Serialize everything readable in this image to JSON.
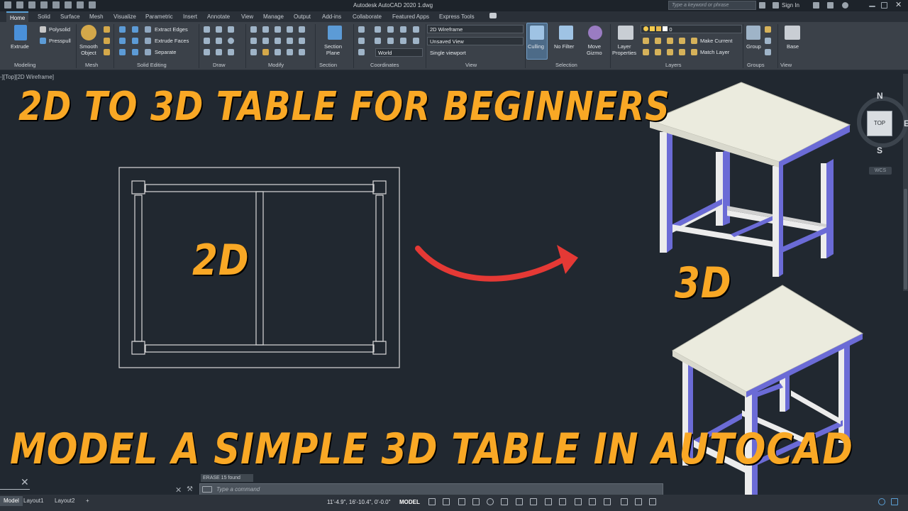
{
  "app": {
    "title": "Autodesk AutoCAD 2020    1.dwg",
    "search_placeholder": "Type a keyword or phrase",
    "sign_in": "Sign In"
  },
  "tabs": [
    "Home",
    "Solid",
    "Surface",
    "Mesh",
    "Visualize",
    "Parametric",
    "Insert",
    "Annotate",
    "View",
    "Manage",
    "Output",
    "Add-ins",
    "Collaborate",
    "Featured Apps",
    "Express Tools"
  ],
  "ribbon": {
    "modeling": {
      "extrude": "Extrude",
      "polysolid": "Polysolid",
      "presspull": "Presspull",
      "label": "Modeling"
    },
    "mesh": {
      "smooth_object_1": "Smooth",
      "smooth_object_2": "Object",
      "label": "Mesh"
    },
    "solid_editing": {
      "extract_edges": "Extract Edges",
      "extrude_faces": "Extrude Faces",
      "separate": "Separate",
      "label": "Solid Editing"
    },
    "draw": {
      "label": "Draw"
    },
    "modify": {
      "label": "Modify"
    },
    "section": {
      "plane_1": "Section",
      "plane_2": "Plane",
      "label": "Section"
    },
    "coordinates": {
      "ucs": "World",
      "label": "Coordinates"
    },
    "view": {
      "visual_style": "2D Wireframe",
      "named_view": "Unsaved View",
      "viewport": "Single viewport",
      "label": "View"
    },
    "selection": {
      "culling": "Culling",
      "no_filter": "No Filter",
      "move_gizmo_1": "Move",
      "move_gizmo_2": "Gizmo",
      "label": "Selection"
    },
    "layers": {
      "layer_properties_1": "Layer",
      "layer_properties_2": "Properties",
      "current_layer": "0",
      "make_current": "Make Current",
      "match_layer": "Match Layer",
      "label": "Layers"
    },
    "groups": {
      "group": "Group",
      "label": "Groups"
    },
    "view2": {
      "base": "Base",
      "label": "View"
    }
  },
  "viewport": {
    "label": "-][Top][2D Wireframe]",
    "title_top": "2D  TO 3D TABLE FOR BEGINNERS",
    "title_bottom": "MODEL A  SIMPLE 3D TABLE IN AUTOCAD",
    "label_2d": "2D",
    "label_3d": "3D"
  },
  "navcube": {
    "north": "N",
    "south": "S",
    "east": "E",
    "top": "TOP",
    "wcs": "WCS"
  },
  "command": {
    "history": "ERASE 15 found",
    "placeholder": "Type a command"
  },
  "status": {
    "layout_tabs": [
      "Model",
      "Layout1",
      "Layout2"
    ],
    "add_tab": "+",
    "coordinates": "11'-4.9\", 16'-10.4\", 0'-0.0\"",
    "space": "MODEL"
  },
  "colors": {
    "title": "#f9a825",
    "arrow": "#e53935",
    "table_top": "#e8e8dc",
    "table_leg_side": "#6b6bd6",
    "background": "#212830"
  }
}
